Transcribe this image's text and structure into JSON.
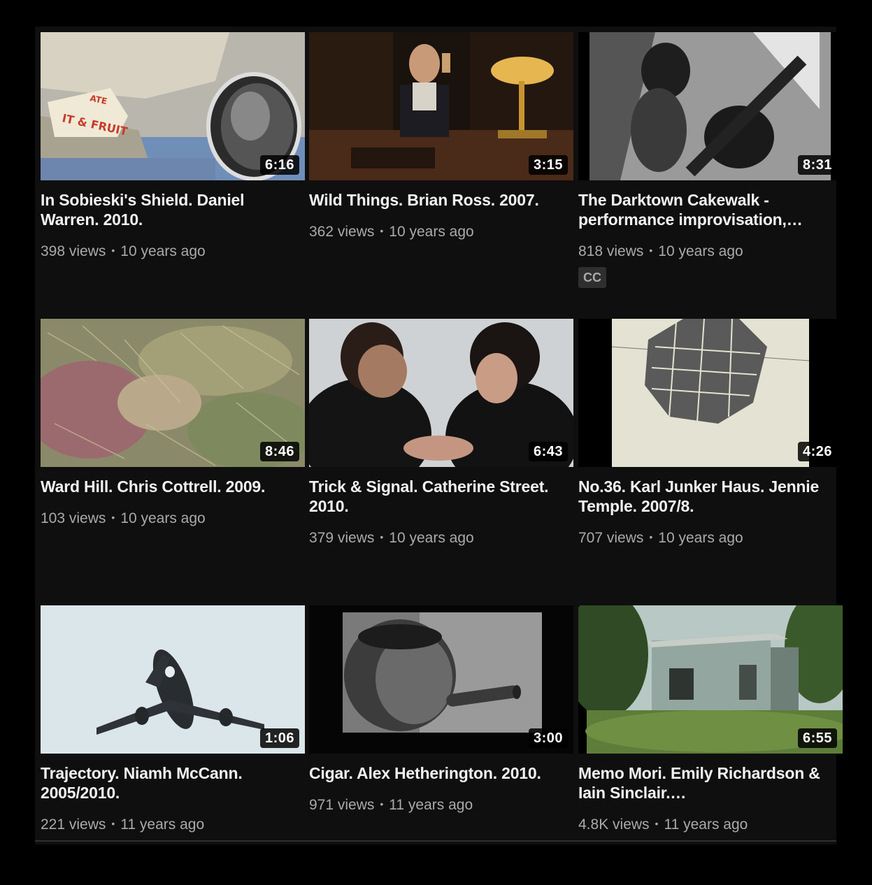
{
  "videos": [
    {
      "title": "In Sobieski's Shield. Daniel Warren. 2010.",
      "duration": "6:16",
      "views": "398 views",
      "age": "10 years ago",
      "badge": ""
    },
    {
      "title": "Wild Things. Brian Ross. 2007.",
      "duration": "3:15",
      "views": "362 views",
      "age": "10 years ago",
      "badge": ""
    },
    {
      "title": "The Darktown Cakewalk - performance improvisation,…",
      "duration": "8:31",
      "views": "818 views",
      "age": "10 years ago",
      "badge": "CC"
    },
    {
      "title": "Ward Hill. Chris Cottrell. 2009.",
      "duration": "8:46",
      "views": "103 views",
      "age": "10 years ago",
      "badge": ""
    },
    {
      "title": "Trick & Signal. Catherine Street. 2010.",
      "duration": "6:43",
      "views": "379 views",
      "age": "10 years ago",
      "badge": ""
    },
    {
      "title": "No.36. Karl Junker Haus. Jennie Temple. 2007/8.",
      "duration": "4:26",
      "views": "707 views",
      "age": "10 years ago",
      "badge": ""
    },
    {
      "title": "Trajectory. Niamh McCann. 2005/2010.",
      "duration": "1:06",
      "views": "221 views",
      "age": "11 years ago",
      "badge": ""
    },
    {
      "title": "Cigar. Alex Hetherington. 2010.",
      "duration": "3:00",
      "views": "971 views",
      "age": "11 years ago",
      "badge": ""
    },
    {
      "title": "Memo Mori. Emily Richardson & Iain Sinclair.…",
      "duration": "6:55",
      "views": "4.8K views",
      "age": "11 years ago",
      "badge": ""
    }
  ],
  "separator": "•",
  "colors": {
    "background": "#0f0f0f",
    "title_text": "#f1f1f1",
    "meta_text": "#aaaaaa",
    "duration_bg": "#000000"
  }
}
